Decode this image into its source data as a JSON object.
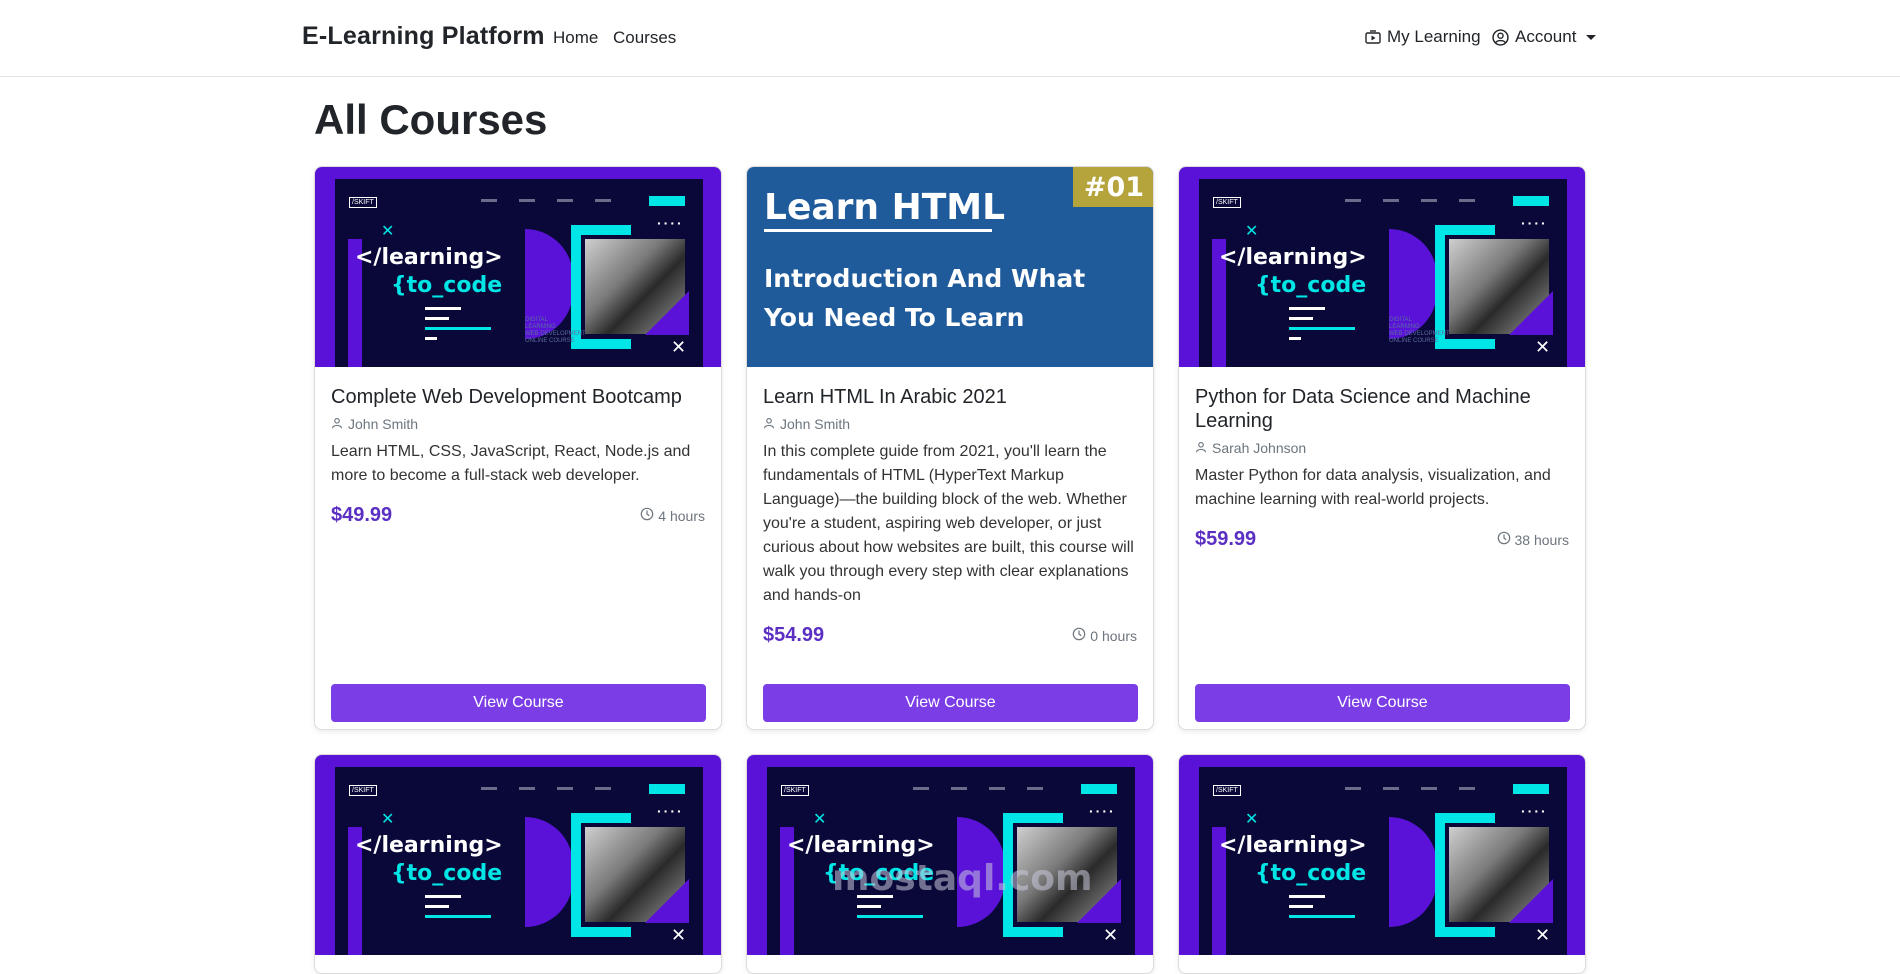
{
  "navbar": {
    "brand": "E-Learning Platform",
    "links": [
      "Home",
      "Courses"
    ],
    "my_learning": "My Learning",
    "account": "Account"
  },
  "page": {
    "title": "All Courses"
  },
  "thumbnails": {
    "code": {
      "line1": "</learning>",
      "line2": "{to_code"
    },
    "html": {
      "title": "Learn HTML",
      "line1": "Introduction And What",
      "line2": "You Need To Learn",
      "badge": "#01"
    }
  },
  "courses": [
    {
      "title": "Complete Web Development Bootcamp",
      "author": "John Smith",
      "description": "Learn HTML, CSS, JavaScript, React, Node.js and more to become a full-stack web developer.",
      "price": "$49.99",
      "duration": "4 hours",
      "button": "View Course"
    },
    {
      "title": "Learn HTML In Arabic 2021",
      "author": "John Smith",
      "description": "In this complete guide from 2021, you'll learn the fundamentals of HTML (HyperText Markup Language)—the building block of the web. Whether you're a student, aspiring web developer, or just curious about how websites are built, this course will walk you through every step with clear explanations and hands-on",
      "price": "$54.99",
      "duration": "0 hours",
      "button": "View Course"
    },
    {
      "title": "Python for Data Science and Machine Learning",
      "author": "Sarah Johnson",
      "description": "Master Python for data analysis, visualization, and machine learning with real-world projects.",
      "price": "$59.99",
      "duration": "38 hours",
      "button": "View Course"
    }
  ],
  "watermark": "mostaql.com",
  "colors": {
    "accent": "#7b3ee6",
    "price": "#5b2fc2",
    "thumb_purple": "#5a12d9",
    "thumb_cyan": "#00e5e5",
    "thumb_blue": "#1f5b9b"
  }
}
